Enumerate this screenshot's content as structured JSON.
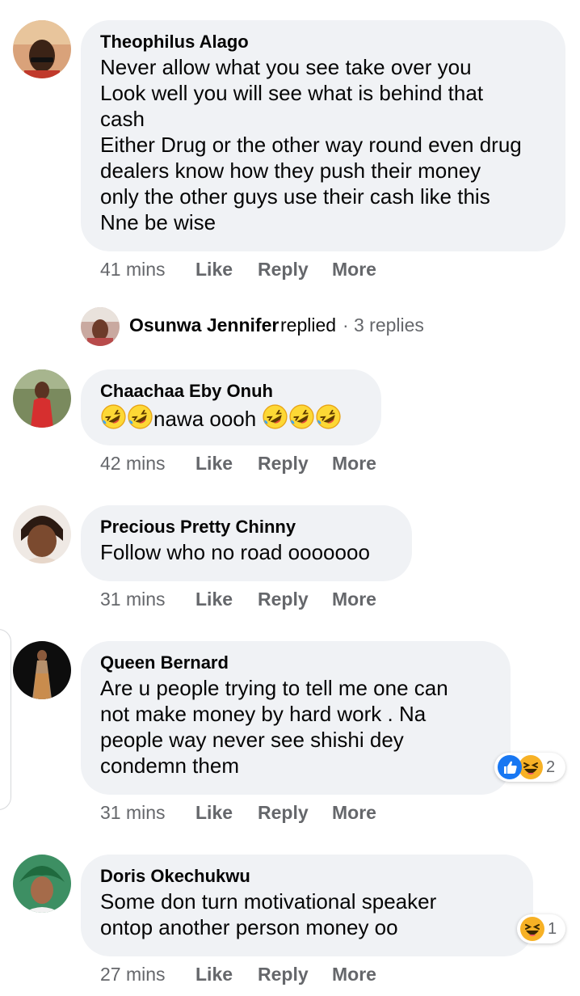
{
  "colors": {
    "bubble": "#f0f2f5",
    "meta_text": "#65676b",
    "like_blue": "#1877f2",
    "haha_yellow": "#f7b125"
  },
  "comments": [
    {
      "author": "Theophilus Alago",
      "text": "Never allow what you see take over you\nLook well you will see what is behind that\ncash\nEither Drug or the other way round even drug\ndealers know how they push their money\nonly the other guys use their cash like this\nNne be wise",
      "time": "41 mins",
      "like": "Like",
      "reply": "Reply",
      "more": "More"
    },
    {
      "author": "Chaachaa Eby Onuh",
      "text": "nawa oooh",
      "emoji": "rolling-on-floor-laughing",
      "time": "42 mins",
      "like": "Like",
      "reply": "Reply",
      "more": "More"
    },
    {
      "author": "Precious Pretty Chinny",
      "text": "Follow who no road ooooooo",
      "time": "31 mins",
      "like": "Like",
      "reply": "Reply",
      "more": "More"
    },
    {
      "author": "Queen Bernard",
      "text": "Are u people trying to tell me one can\nnot make money by hard work . Na\npeople way never see shishi dey\ncondemn them",
      "time": "31 mins",
      "like": "Like",
      "reply": "Reply",
      "more": "More",
      "reactions": {
        "icons": [
          "like-icon",
          "haha-icon"
        ],
        "count": "2"
      }
    },
    {
      "author": "Doris Okechukwu",
      "text": "Some don turn motivational speaker\nontop another person money oo",
      "time": "27 mins",
      "like": "Like",
      "reply": "Reply",
      "more": "More",
      "reactions": {
        "icons": [
          "haha-icon"
        ],
        "count": "1"
      }
    }
  ],
  "reply_summary": {
    "name": "Osunwa Jennifer",
    "verb": "replied",
    "separator": "·",
    "count": "3 replies"
  }
}
